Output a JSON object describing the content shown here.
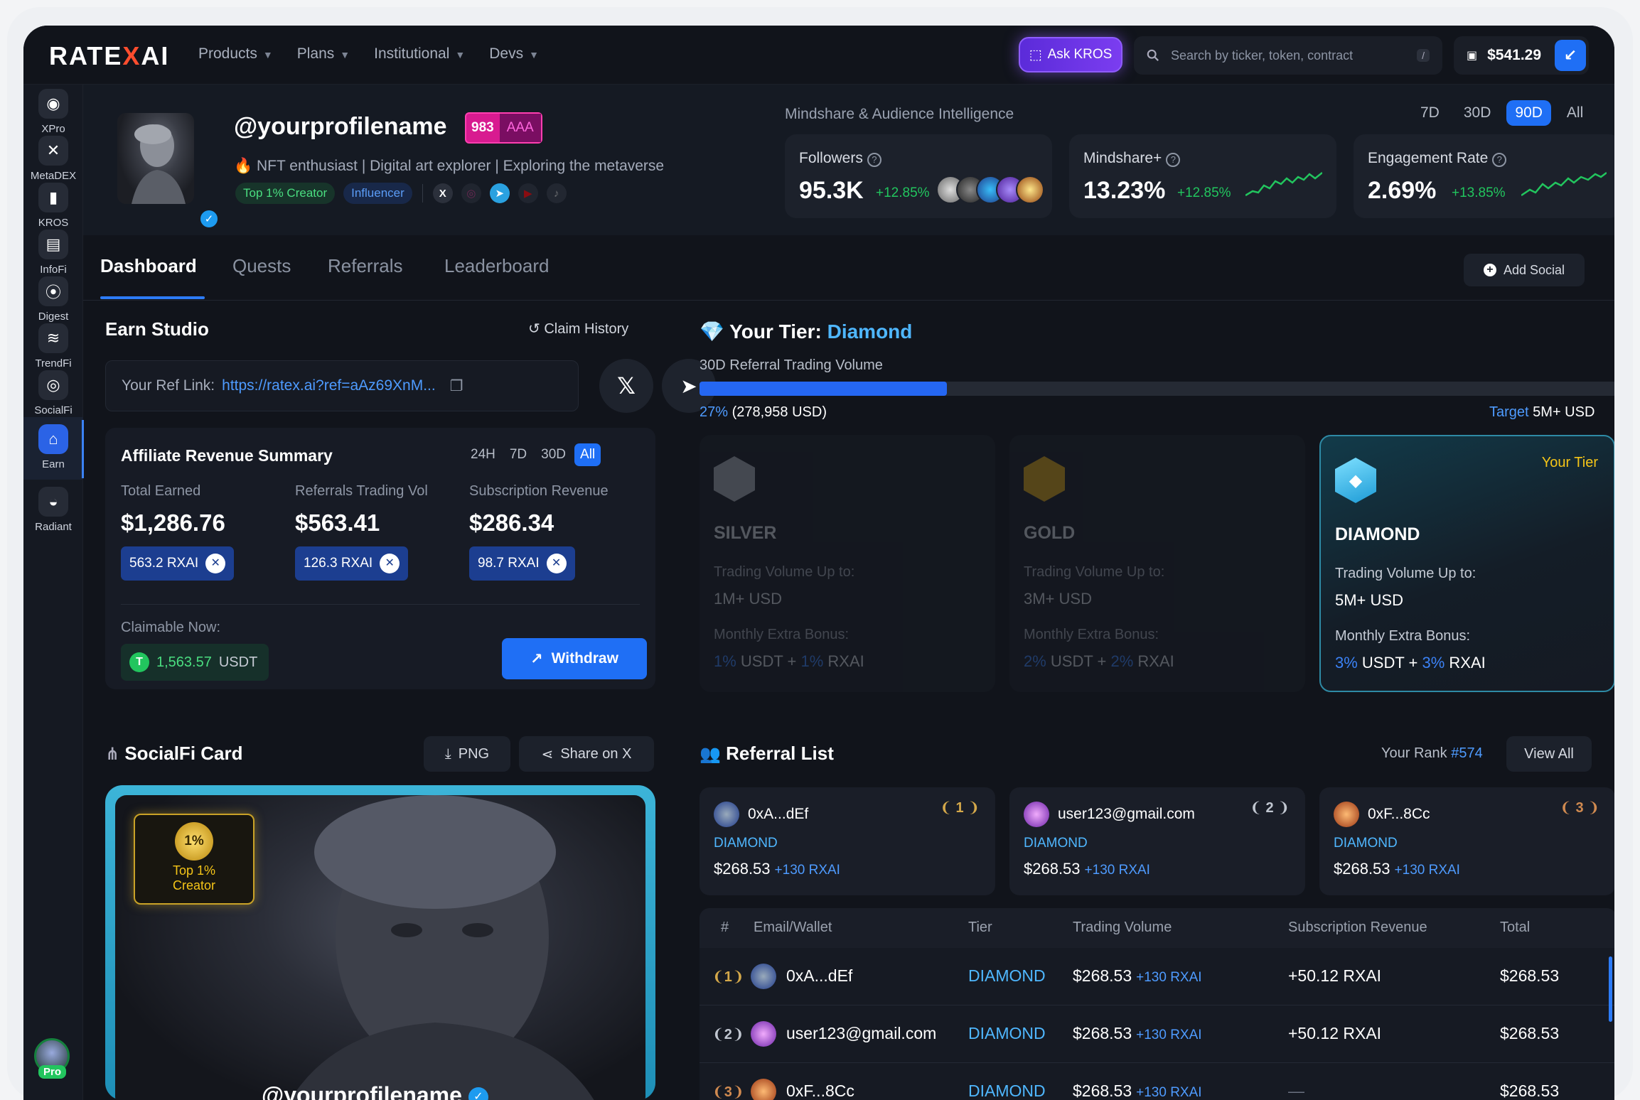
{
  "brand": {
    "logo_a": "RATE",
    "logo_x": "X",
    "logo_b": "AI"
  },
  "nav": [
    "Products",
    "Plans",
    "Institutional",
    "Devs"
  ],
  "ask_label": "Ask KROS",
  "search": {
    "placeholder": "Search by ticker, token, contract",
    "shortcut": "/"
  },
  "wallet": {
    "balance": "$541.29"
  },
  "sidebar": [
    {
      "label": "XPro",
      "icon": "compass-icon"
    },
    {
      "label": "MetaDEX",
      "icon": "x-icon"
    },
    {
      "label": "KROS",
      "icon": "kros-icon"
    },
    {
      "label": "InfoFi",
      "icon": "newspaper-icon"
    },
    {
      "label": "Digest",
      "icon": "broadcast-icon"
    },
    {
      "label": "TrendFi",
      "icon": "layers-icon"
    },
    {
      "label": "SocialFi",
      "icon": "target-icon"
    },
    {
      "label": "Earn",
      "icon": "gift-icon"
    },
    {
      "label": "Radiant",
      "icon": "eye-icon"
    }
  ],
  "pro_label": "Pro",
  "profile": {
    "name": "@yourprofilename",
    "score": "983",
    "grade": "AAA",
    "bio": "NFT enthusiast | Digital art explorer | Exploring the metaverse",
    "chips": [
      "Top 1% Creator",
      "Influencer"
    ]
  },
  "mindshare": {
    "title": "Mindshare & Audience Intelligence",
    "ranges": [
      "7D",
      "30D",
      "90D",
      "All"
    ],
    "active_range": "90D",
    "cards": [
      {
        "label": "Followers",
        "value": "95.3K",
        "delta": "+12.85%"
      },
      {
        "label": "Mindshare+",
        "value": "13.23%",
        "delta": "+12.85%"
      },
      {
        "label": "Engagement Rate",
        "value": "2.69%",
        "delta": "+13.85%"
      }
    ]
  },
  "tabs": [
    "Dashboard",
    "Quests",
    "Referrals",
    "Leaderboard"
  ],
  "add_social": "Add Social",
  "earn": {
    "title": "Earn Studio",
    "claim_history": "Claim History",
    "ref_label": "Your Ref Link:",
    "ref_url": "https://ratex.ai?ref=aAz69XnM..."
  },
  "affiliate": {
    "title": "Affiliate Revenue Summary",
    "ranges": [
      "24H",
      "7D",
      "30D",
      "All"
    ],
    "active_range": "All",
    "cols": [
      {
        "label": "Total Earned",
        "value": "$1,286.76",
        "pill": "563.2 RXAI"
      },
      {
        "label": "Referrals Trading Vol",
        "value": "$563.41",
        "pill": "126.3 RXAI"
      },
      {
        "label": "Subscription Revenue",
        "value": "$286.34",
        "pill": "98.7 RXAI"
      }
    ],
    "claimable_label": "Claimable Now:",
    "claimable_value": "1,563.57",
    "claimable_unit": "USDT",
    "withdraw": "Withdraw"
  },
  "tier": {
    "title": "Your Tier:",
    "name": "Diamond",
    "volume_label": "30D Referral Trading Volume",
    "progress": 0.27,
    "pct": "27%",
    "usd": "(278,958 USD)",
    "target_label": "Target",
    "target": "5M+ USD",
    "cards": [
      {
        "name": "SILVER",
        "vol_label": "Trading Volume Up to:",
        "vol": "1M+ USD",
        "bonus_label": "Monthly Extra Bonus:",
        "b1": "1%",
        "b1u": "USDT +",
        "b2": "1%",
        "b2u": "RXAI"
      },
      {
        "name": "GOLD",
        "vol_label": "Trading Volume Up to:",
        "vol": "3M+ USD",
        "bonus_label": "Monthly Extra Bonus:",
        "b1": "2%",
        "b1u": "USDT +",
        "b2": "2%",
        "b2u": "RXAI"
      },
      {
        "name": "DIAMOND",
        "vol_label": "Trading Volume Up to:",
        "vol": "5M+ USD",
        "bonus_label": "Monthly Extra Bonus:",
        "b1": "3%",
        "b1u": "USDT +",
        "b2": "3%",
        "b2u": "RXAI",
        "your": "Your Tier"
      }
    ]
  },
  "socialfi": {
    "title": "SocialFi Card",
    "png": "PNG",
    "share": "Share on X",
    "badge_top": "1%",
    "badge_text1": "Top 1%",
    "badge_text2": "Creator",
    "name": "@yourprofilename"
  },
  "referral": {
    "title": "Referral List",
    "rank_label": "Your Rank",
    "rank": "#574",
    "view_all": "View All",
    "top": [
      {
        "name": "0xA...dEf",
        "rank": "1",
        "tier": "DIAMOND",
        "amount": "$268.53",
        "bonus": "+130 RXAI"
      },
      {
        "name": "user123@gmail.com",
        "rank": "2",
        "tier": "DIAMOND",
        "amount": "$268.53",
        "bonus": "+130 RXAI"
      },
      {
        "name": "0xF...8Cc",
        "rank": "3",
        "tier": "DIAMOND",
        "amount": "$268.53",
        "bonus": "+130 RXAI"
      }
    ],
    "headers": [
      "#",
      "Email/Wallet",
      "Tier",
      "Trading Volume",
      "Subscription Revenue",
      "Total"
    ],
    "rows": [
      {
        "rank": "1",
        "name": "0xA...dEf",
        "tier": "DIAMOND",
        "vol": "$268.53",
        "vol_bonus": "+130 RXAI",
        "sub": "+50.12 RXAI",
        "total": "$268.53"
      },
      {
        "rank": "2",
        "name": "user123@gmail.com",
        "tier": "DIAMOND",
        "vol": "$268.53",
        "vol_bonus": "+130 RXAI",
        "sub": "+50.12 RXAI",
        "total": "$268.53"
      },
      {
        "rank": "3",
        "name": "0xF...8Cc",
        "tier": "DIAMOND",
        "vol": "$268.53",
        "vol_bonus": "+130 RXAI",
        "sub": "—",
        "total": "$268.53"
      }
    ]
  }
}
